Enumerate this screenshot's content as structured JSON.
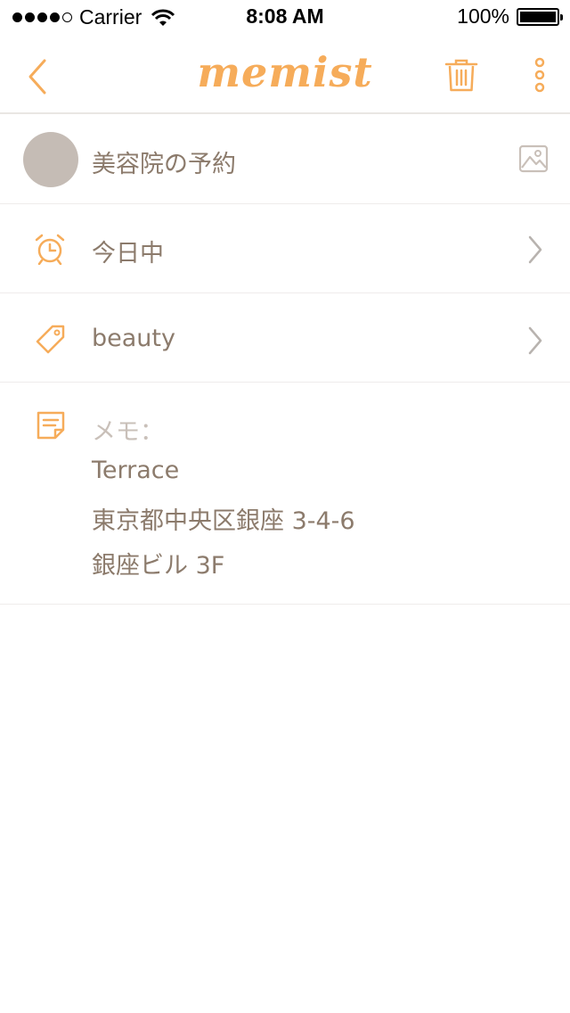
{
  "status_bar": {
    "carrier": "Carrier",
    "time": "8:08 AM",
    "battery": "100%"
  },
  "navbar": {
    "logo": "memist",
    "back_icon": "chevron-left-icon",
    "trash_icon": "trash-icon",
    "more_icon": "more-vertical-icon"
  },
  "title_row": {
    "title": "美容院の予約",
    "image_icon": "image-icon"
  },
  "reminder_row": {
    "label": "今日中",
    "icon": "alarm-clock-icon"
  },
  "tag_row": {
    "label": "beauty",
    "icon": "tag-icon"
  },
  "memo": {
    "label": "メモ：",
    "icon": "note-icon",
    "lines": [
      "Terrace",
      "東京都中央区銀座 3-4-6",
      "銀座ビル 3F"
    ]
  },
  "colors": {
    "accent": "#f6ac5a",
    "text": "#8c7b6c",
    "placeholder": "#c9c0b9",
    "avatar": "#c5bcb5",
    "divider": "#efeceb"
  }
}
